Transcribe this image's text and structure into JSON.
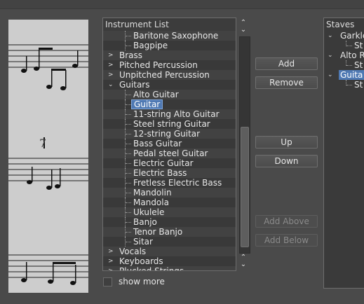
{
  "instrument_list": {
    "title": "Instrument List",
    "items": [
      {
        "label": "Baritone Saxophone",
        "level": "child"
      },
      {
        "label": "Bagpipe",
        "level": "child"
      },
      {
        "label": "Brass",
        "level": "category",
        "expanded": false
      },
      {
        "label": "Pitched Percussion",
        "level": "category",
        "expanded": false
      },
      {
        "label": "Unpitched Percussion",
        "level": "category",
        "expanded": false
      },
      {
        "label": "Guitars",
        "level": "category",
        "expanded": true
      },
      {
        "label": "Alto Guitar",
        "level": "child"
      },
      {
        "label": "Guitar",
        "level": "child",
        "selected": true
      },
      {
        "label": "11-string Alto Guitar",
        "level": "child"
      },
      {
        "label": "Steel string Guitar",
        "level": "child"
      },
      {
        "label": "12-string Guitar",
        "level": "child"
      },
      {
        "label": "Bass Guitar",
        "level": "child"
      },
      {
        "label": "Pedal steel Guitar",
        "level": "child"
      },
      {
        "label": "Electric Guitar",
        "level": "child"
      },
      {
        "label": "Electric Bass",
        "level": "child"
      },
      {
        "label": "Fretless Electric Bass",
        "level": "child"
      },
      {
        "label": "Mandolin",
        "level": "child"
      },
      {
        "label": "Mandola",
        "level": "child"
      },
      {
        "label": "Ukulele",
        "level": "child"
      },
      {
        "label": "Banjo",
        "level": "child"
      },
      {
        "label": "Tenor Banjo",
        "level": "child"
      },
      {
        "label": "Sitar",
        "level": "child"
      },
      {
        "label": "Vocals",
        "level": "category",
        "expanded": false
      },
      {
        "label": "Keyboards",
        "level": "category",
        "expanded": false
      },
      {
        "label": "Plucked Strings",
        "level": "category",
        "expanded": false
      }
    ]
  },
  "buttons": {
    "add": "Add",
    "remove": "Remove",
    "up": "Up",
    "down": "Down",
    "add_above": "Add Above",
    "add_below": "Add Below"
  },
  "show_more": {
    "label": "show more",
    "checked": false
  },
  "staves": {
    "title": "Staves",
    "items": [
      {
        "label": "Garkle",
        "type": "part"
      },
      {
        "label": "St",
        "type": "staff"
      },
      {
        "label": "Alto R",
        "type": "part"
      },
      {
        "label": "St",
        "type": "staff"
      },
      {
        "label": "Guita",
        "type": "part",
        "selected": true
      },
      {
        "label": "St",
        "type": "staff"
      }
    ]
  },
  "colors": {
    "background": "#4a4a4a",
    "selection": "#4f79b3",
    "panel": "#3c3c3c"
  },
  "icons": {
    "collapsed": "chevron-right-icon",
    "expanded": "chevron-down-icon",
    "scroll_up": "chevron-up-icon",
    "scroll_down": "chevron-down-icon"
  }
}
